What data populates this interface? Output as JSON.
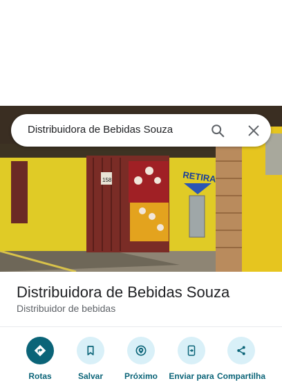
{
  "search": {
    "query": "Distribuidora de Bebidas Souza"
  },
  "place": {
    "name": "Distribuidora de Bebidas Souza",
    "category": "Distribuidor de bebidas"
  },
  "photo": {
    "sign_text": "RETIRADA",
    "house_number": "158"
  },
  "actions": [
    {
      "label": "Rotas",
      "icon": "directions-icon"
    },
    {
      "label": "Salvar",
      "icon": "bookmark-icon"
    },
    {
      "label": "Próximo",
      "icon": "nearby-icon"
    },
    {
      "label": "Enviar para",
      "icon": "send-to-phone-icon"
    },
    {
      "label": "Compartilha",
      "icon": "share-icon"
    }
  ],
  "colors": {
    "accent": "#0b6478",
    "chip_bg": "#d9f0f8",
    "wall_yellow": "#e8d22a"
  }
}
